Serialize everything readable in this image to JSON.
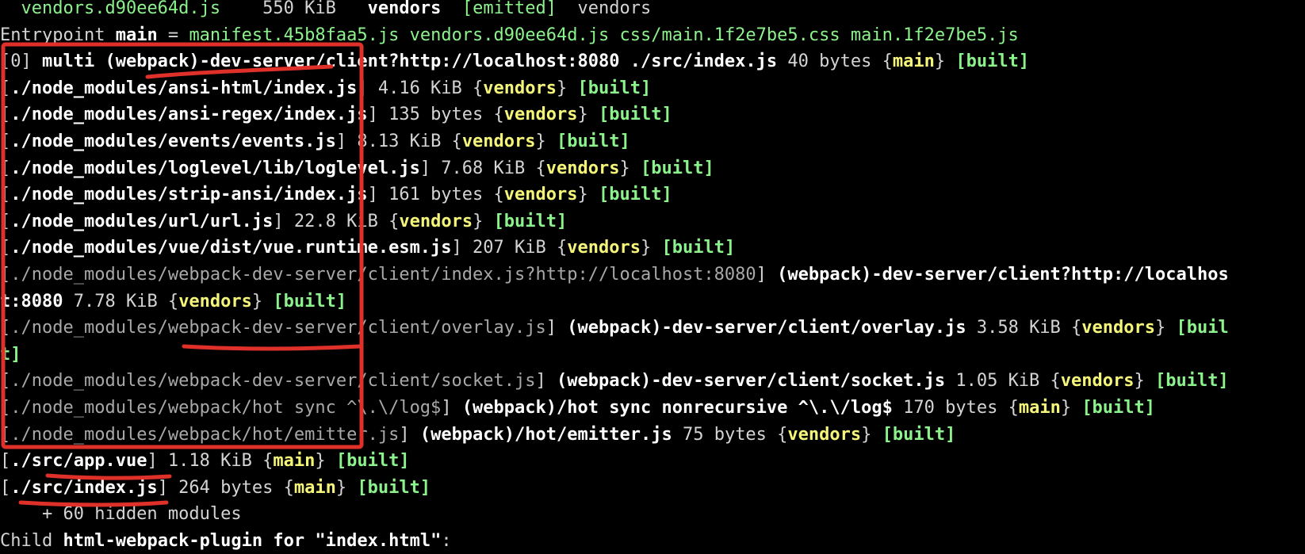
{
  "terminal": {
    "lines": [
      {
        "segments": [
          {
            "t": "  ",
            "c": "w"
          },
          {
            "t": "vendors.d90ee64d.js",
            "c": "g"
          },
          {
            "t": "    550 KiB   ",
            "c": "w"
          },
          {
            "t": "vendors",
            "c": "b"
          },
          {
            "t": "  ",
            "c": "w"
          },
          {
            "t": "[emitted]",
            "c": "g"
          },
          {
            "t": "  vendors",
            "c": "w"
          }
        ]
      },
      {
        "segments": [
          {
            "t": "Entrypoint ",
            "c": "w"
          },
          {
            "t": "main",
            "c": "b"
          },
          {
            "t": " = ",
            "c": "w"
          },
          {
            "t": "manifest.45b8faa5.js vendors.d90ee64d.js css/main.1f2e7be5.css main.1f2e7be5.js",
            "c": "g"
          }
        ]
      },
      {
        "segments": [
          {
            "t": "[0] ",
            "c": "w"
          },
          {
            "t": "multi (webpack)-dev-server/client?http://localhost:8080 ./src/index.js",
            "c": "b"
          },
          {
            "t": " 40 bytes {",
            "c": "w"
          },
          {
            "t": "main",
            "c": "y"
          },
          {
            "t": "} ",
            "c": "w"
          },
          {
            "t": "[built]",
            "c": "gb"
          }
        ]
      },
      {
        "segments": [
          {
            "t": "[",
            "c": "w"
          },
          {
            "t": "./node_modules/ansi-html/index.js",
            "c": "b"
          },
          {
            "t": "] 4.16 KiB {",
            "c": "w"
          },
          {
            "t": "vendors",
            "c": "y"
          },
          {
            "t": "} ",
            "c": "w"
          },
          {
            "t": "[built]",
            "c": "gb"
          }
        ]
      },
      {
        "segments": [
          {
            "t": "[",
            "c": "w"
          },
          {
            "t": "./node_modules/ansi-regex/index.js",
            "c": "b"
          },
          {
            "t": "] 135 bytes {",
            "c": "w"
          },
          {
            "t": "vendors",
            "c": "y"
          },
          {
            "t": "} ",
            "c": "w"
          },
          {
            "t": "[built]",
            "c": "gb"
          }
        ]
      },
      {
        "segments": [
          {
            "t": "[",
            "c": "w"
          },
          {
            "t": "./node_modules/events/events.js",
            "c": "b"
          },
          {
            "t": "] 8.13 KiB {",
            "c": "w"
          },
          {
            "t": "vendors",
            "c": "y"
          },
          {
            "t": "} ",
            "c": "w"
          },
          {
            "t": "[built]",
            "c": "gb"
          }
        ]
      },
      {
        "segments": [
          {
            "t": "[",
            "c": "w"
          },
          {
            "t": "./node_modules/loglevel/lib/loglevel.js",
            "c": "b"
          },
          {
            "t": "] 7.68 KiB {",
            "c": "w"
          },
          {
            "t": "vendors",
            "c": "y"
          },
          {
            "t": "} ",
            "c": "w"
          },
          {
            "t": "[built]",
            "c": "gb"
          }
        ]
      },
      {
        "segments": [
          {
            "t": "[",
            "c": "w"
          },
          {
            "t": "./node_modules/strip-ansi/index.js",
            "c": "b"
          },
          {
            "t": "] 161 bytes {",
            "c": "w"
          },
          {
            "t": "vendors",
            "c": "y"
          },
          {
            "t": "} ",
            "c": "w"
          },
          {
            "t": "[built]",
            "c": "gb"
          }
        ]
      },
      {
        "segments": [
          {
            "t": "[",
            "c": "w"
          },
          {
            "t": "./node_modules/url/url.js",
            "c": "b"
          },
          {
            "t": "] 22.8 KiB {",
            "c": "w"
          },
          {
            "t": "vendors",
            "c": "y"
          },
          {
            "t": "} ",
            "c": "w"
          },
          {
            "t": "[built]",
            "c": "gb"
          }
        ]
      },
      {
        "segments": [
          {
            "t": "[",
            "c": "w"
          },
          {
            "t": "./node_modules/vue/dist/vue.runtime.esm.js",
            "c": "b"
          },
          {
            "t": "] 207 KiB {",
            "c": "w"
          },
          {
            "t": "vendors",
            "c": "y"
          },
          {
            "t": "} ",
            "c": "w"
          },
          {
            "t": "[built]",
            "c": "gb"
          }
        ]
      },
      {
        "segments": [
          {
            "t": "[",
            "c": "w"
          },
          {
            "t": "./node_modules/webpack-dev-server/client/index.js?http://localhost:8080",
            "c": "dim"
          },
          {
            "t": "] ",
            "c": "w"
          },
          {
            "t": "(webpack)-dev-server/client?http://localhos",
            "c": "b"
          }
        ]
      },
      {
        "segments": [
          {
            "t": "t:8080",
            "c": "b"
          },
          {
            "t": " 7.78 KiB {",
            "c": "w"
          },
          {
            "t": "vendors",
            "c": "y"
          },
          {
            "t": "} ",
            "c": "w"
          },
          {
            "t": "[built]",
            "c": "gb"
          }
        ]
      },
      {
        "segments": [
          {
            "t": "[",
            "c": "w"
          },
          {
            "t": "./node_modules/webpack-dev-server/client/overlay.js",
            "c": "dim"
          },
          {
            "t": "] ",
            "c": "w"
          },
          {
            "t": "(webpack)-dev-server/client/overlay.js",
            "c": "b"
          },
          {
            "t": " 3.58 KiB {",
            "c": "w"
          },
          {
            "t": "vendors",
            "c": "y"
          },
          {
            "t": "} ",
            "c": "w"
          },
          {
            "t": "[buil",
            "c": "gb"
          }
        ]
      },
      {
        "segments": [
          {
            "t": "t]",
            "c": "gb"
          }
        ]
      },
      {
        "segments": [
          {
            "t": "[",
            "c": "w"
          },
          {
            "t": "./node_modules/webpack-dev-server/client/socket.js",
            "c": "dim"
          },
          {
            "t": "] ",
            "c": "w"
          },
          {
            "t": "(webpack)-dev-server/client/socket.js",
            "c": "b"
          },
          {
            "t": " 1.05 KiB {",
            "c": "w"
          },
          {
            "t": "vendors",
            "c": "y"
          },
          {
            "t": "} ",
            "c": "w"
          },
          {
            "t": "[built]",
            "c": "gb"
          }
        ]
      },
      {
        "segments": [
          {
            "t": "[",
            "c": "w"
          },
          {
            "t": "./node_modules/webpack/hot sync ^\\.\\/log$",
            "c": "dim"
          },
          {
            "t": "] ",
            "c": "w"
          },
          {
            "t": "(webpack)/hot sync nonrecursive ^\\.\\/log$",
            "c": "b"
          },
          {
            "t": " 170 bytes {",
            "c": "w"
          },
          {
            "t": "main",
            "c": "y"
          },
          {
            "t": "} ",
            "c": "w"
          },
          {
            "t": "[built]",
            "c": "gb"
          }
        ]
      },
      {
        "segments": [
          {
            "t": "[",
            "c": "w"
          },
          {
            "t": "./node_modules/webpack/hot/emitter.js",
            "c": "dim"
          },
          {
            "t": "] ",
            "c": "w"
          },
          {
            "t": "(webpack)/hot/emitter.js",
            "c": "b"
          },
          {
            "t": " 75 bytes {",
            "c": "w"
          },
          {
            "t": "vendors",
            "c": "y"
          },
          {
            "t": "} ",
            "c": "w"
          },
          {
            "t": "[built]",
            "c": "gb"
          }
        ]
      },
      {
        "segments": [
          {
            "t": "[",
            "c": "w"
          },
          {
            "t": "./src/app.vue",
            "c": "b"
          },
          {
            "t": "] 1.18 KiB {",
            "c": "w"
          },
          {
            "t": "main",
            "c": "y"
          },
          {
            "t": "} ",
            "c": "w"
          },
          {
            "t": "[built]",
            "c": "gb"
          }
        ]
      },
      {
        "segments": [
          {
            "t": "[",
            "c": "w"
          },
          {
            "t": "./src/index.js",
            "c": "b"
          },
          {
            "t": "] 264 bytes {",
            "c": "w"
          },
          {
            "t": "main",
            "c": "y"
          },
          {
            "t": "} ",
            "c": "w"
          },
          {
            "t": "[built]",
            "c": "gb"
          }
        ]
      },
      {
        "segments": [
          {
            "t": "    + 60 hidden modules",
            "c": "w"
          }
        ]
      },
      {
        "segments": [
          {
            "t": "Child ",
            "c": "w"
          },
          {
            "t": "html-webpack-plugin for \"index.html\"",
            "c": "b"
          },
          {
            "t": ":",
            "c": "w"
          }
        ]
      }
    ]
  },
  "colors": {
    "background": "#000000",
    "default_text": "#d4d4d4",
    "bright_text": "#ffffff",
    "green": "#8cf28c",
    "yellow": "#f5f57a",
    "dim": "#a8a8a8",
    "annotation_red": "#e0302a"
  }
}
